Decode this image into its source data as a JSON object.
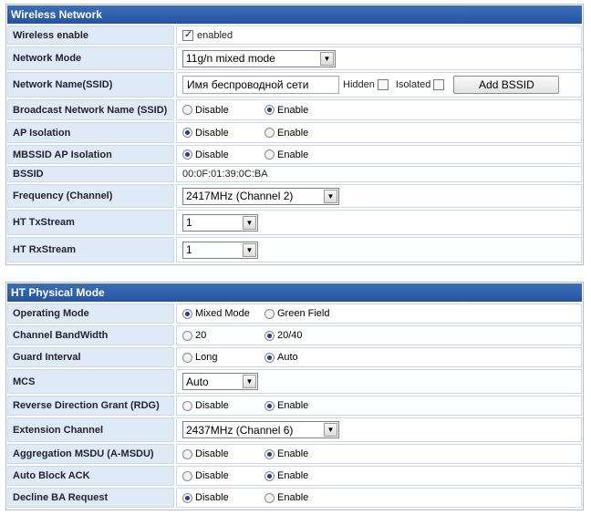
{
  "wireless": {
    "title": "Wireless Network",
    "wireless_enable": {
      "label": "Wireless enable",
      "checkbox_label": "enabled"
    },
    "network_mode": {
      "label": "Network Mode",
      "value": "11g/n mixed mode"
    },
    "ssid": {
      "label": "Network Name(SSID)",
      "value": "Имя беспроводной сети",
      "hidden_label": "Hidden",
      "isolated_label": "Isolated",
      "add_button": "Add BSSID"
    },
    "broadcast": {
      "label": "Broadcast Network Name (SSID)",
      "opt1": "Disable",
      "opt2": "Enable"
    },
    "ap_isolation": {
      "label": "AP Isolation",
      "opt1": "Disable",
      "opt2": "Enable"
    },
    "mbssid_isolation": {
      "label": "MBSSID AP Isolation",
      "opt1": "Disable",
      "opt2": "Enable"
    },
    "bssid": {
      "label": "BSSID",
      "value": "00:0F:01:39:0C:BA"
    },
    "frequency": {
      "label": "Frequency (Channel)",
      "value": "2417MHz (Channel 2)"
    },
    "tx_stream": {
      "label": "HT TxStream",
      "value": "1"
    },
    "rx_stream": {
      "label": "HT RxStream",
      "value": "1"
    }
  },
  "ht": {
    "title": "HT Physical Mode",
    "operating_mode": {
      "label": "Operating Mode",
      "opt1": "Mixed Mode",
      "opt2": "Green Field"
    },
    "bandwidth": {
      "label": "Channel BandWidth",
      "opt1": "20",
      "opt2": "20/40"
    },
    "guard_interval": {
      "label": "Guard Interval",
      "opt1": "Long",
      "opt2": "Auto"
    },
    "mcs": {
      "label": "MCS",
      "value": "Auto"
    },
    "rdg": {
      "label": "Reverse Direction Grant (RDG)",
      "opt1": "Disable",
      "opt2": "Enable"
    },
    "extension_channel": {
      "label": "Extension Channel",
      "value": "2437MHz (Channel 6)"
    },
    "amsdu": {
      "label": "Aggregation MSDU (A-MSDU)",
      "opt1": "Disable",
      "opt2": "Enable"
    },
    "auto_block_ack": {
      "label": "Auto Block ACK",
      "opt1": "Disable",
      "opt2": "Enable"
    },
    "decline_ba": {
      "label": "Decline BA Request",
      "opt1": "Disable",
      "opt2": "Enable"
    }
  },
  "colors": {
    "header": "#2a5aa8",
    "label_bg": "#deebf6",
    "border": "#b0bccb"
  }
}
